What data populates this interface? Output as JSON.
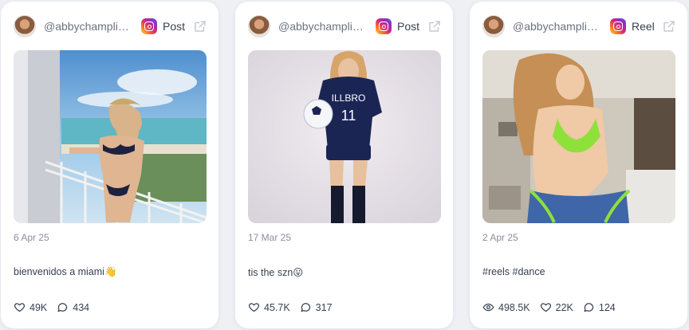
{
  "cards": [
    {
      "username": "@abbychamplin...",
      "platform_icon": "instagram-icon",
      "post_type": "Post",
      "date": "6 Apr 25",
      "caption": "bienvenidos a miami👋",
      "stats": {
        "views": null,
        "likes": "49K",
        "comments": "434"
      }
    },
    {
      "username": "@abbychamplin...",
      "platform_icon": "instagram-icon",
      "post_type": "Post",
      "date": "17 Mar 25",
      "caption": "tis the szn😛",
      "stats": {
        "views": null,
        "likes": "45.7K",
        "comments": "317"
      }
    },
    {
      "username": "@abbychamplin...",
      "platform_icon": "instagram-icon",
      "post_type": "Reel",
      "date": "2 Apr 25",
      "caption": "#reels #dance",
      "stats": {
        "views": "498.5K",
        "likes": "22K",
        "comments": "124"
      }
    }
  ],
  "colors": {
    "page_bg": "#eef0f4",
    "card_bg": "#ffffff",
    "muted_text": "#8a8f9c",
    "body_text": "#374151"
  }
}
